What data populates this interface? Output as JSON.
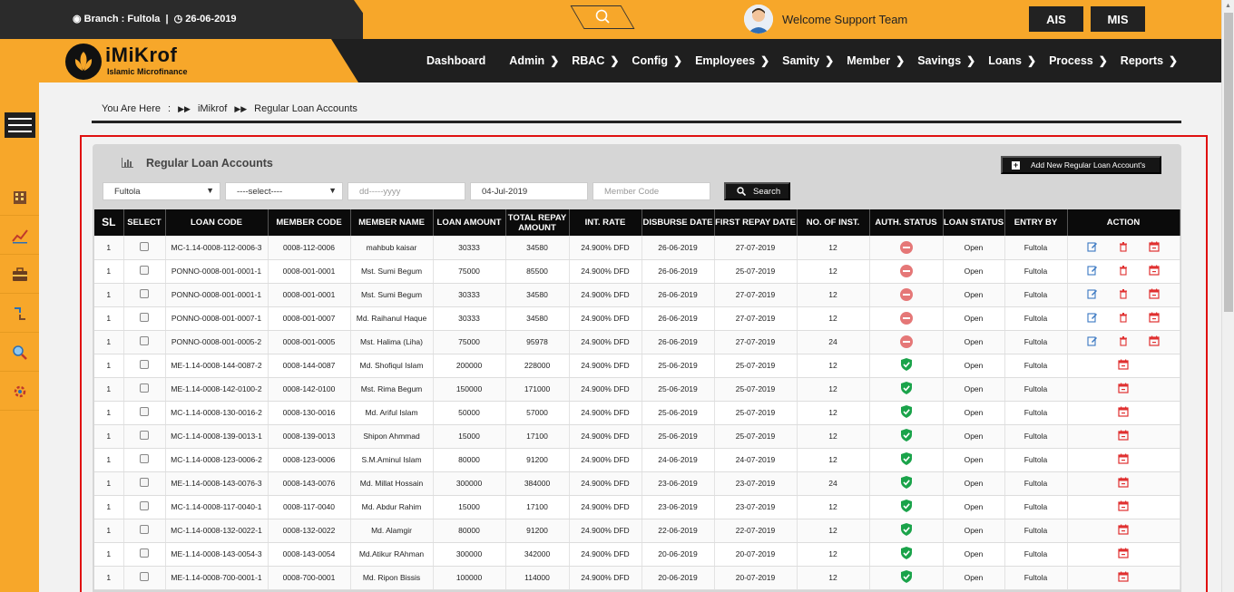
{
  "topbar": {
    "branch_label": "Branch : Fultola",
    "separator": "|",
    "date": "26-06-2019",
    "welcome": "Welcome Support Team",
    "btn_ais": "AIS",
    "btn_mis": "MIS"
  },
  "logo": {
    "title": "iMiKrof",
    "subtitle": "Islamic Microfinance"
  },
  "nav": [
    {
      "label": "Dashboard",
      "chevron": false
    },
    {
      "label": "Admin",
      "chevron": true
    },
    {
      "label": "RBAC",
      "chevron": true
    },
    {
      "label": "Config",
      "chevron": true
    },
    {
      "label": "Employees",
      "chevron": true
    },
    {
      "label": "Samity",
      "chevron": true
    },
    {
      "label": "Member",
      "chevron": true
    },
    {
      "label": "Savings",
      "chevron": true
    },
    {
      "label": "Loans",
      "chevron": true
    },
    {
      "label": "Process",
      "chevron": true
    },
    {
      "label": "Reports",
      "chevron": true
    }
  ],
  "breadcrumb": {
    "lead": "You Are Here",
    "colon": ":",
    "root": "iMikrof",
    "current": "Regular Loan Accounts"
  },
  "panel": {
    "title": "Regular Loan Accounts",
    "add_button": "Add New Regular Loan Account's"
  },
  "filters": {
    "branch": "Fultola",
    "product": "----select----",
    "date_from_placeholder": "dd-----yyyy",
    "date_to": "04-Jul-2019",
    "member_code_placeholder": "Member Code",
    "search_label": "Search"
  },
  "table": {
    "headers": [
      "SL",
      "SELECT",
      "LOAN CODE",
      "MEMBER CODE",
      "MEMBER NAME",
      "LOAN AMOUNT",
      "TOTAL REPAY AMOUNT",
      "INT. RATE",
      "DISBURSE DATE",
      "FIRST REPAY DATE",
      "NO. OF INST.",
      "AUTH. STATUS",
      "LOAN STATUS",
      "ENTRY BY",
      "ACTION"
    ],
    "rows": [
      {
        "sl": "1",
        "loan_code": "MC-1.14-0008-112-0006-3",
        "member_code": "0008-112-0006",
        "member_name": "mahbub kaisar",
        "loan_amount": "30333",
        "total_repay": "34580",
        "int_rate": "24.900% DFD",
        "disburse": "26-06-2019",
        "first_repay": "27-07-2019",
        "inst": "12",
        "auth": "pending",
        "loan_status": "Open",
        "entry_by": "Fultola",
        "full_actions": true
      },
      {
        "sl": "1",
        "loan_code": "PONNO-0008-001-0001-1",
        "member_code": "0008-001-0001",
        "member_name": "Mst. Sumi Begum",
        "loan_amount": "75000",
        "total_repay": "85500",
        "int_rate": "24.900% DFD",
        "disburse": "26-06-2019",
        "first_repay": "25-07-2019",
        "inst": "12",
        "auth": "pending",
        "loan_status": "Open",
        "entry_by": "Fultola",
        "full_actions": true
      },
      {
        "sl": "1",
        "loan_code": "PONNO-0008-001-0001-1",
        "member_code": "0008-001-0001",
        "member_name": "Mst. Sumi Begum",
        "loan_amount": "30333",
        "total_repay": "34580",
        "int_rate": "24.900% DFD",
        "disburse": "26-06-2019",
        "first_repay": "27-07-2019",
        "inst": "12",
        "auth": "pending",
        "loan_status": "Open",
        "entry_by": "Fultola",
        "full_actions": true
      },
      {
        "sl": "1",
        "loan_code": "PONNO-0008-001-0007-1",
        "member_code": "0008-001-0007",
        "member_name": "Md. Raihanul Haque",
        "loan_amount": "30333",
        "total_repay": "34580",
        "int_rate": "24.900% DFD",
        "disburse": "26-06-2019",
        "first_repay": "27-07-2019",
        "inst": "12",
        "auth": "pending",
        "loan_status": "Open",
        "entry_by": "Fultola",
        "full_actions": true
      },
      {
        "sl": "1",
        "loan_code": "PONNO-0008-001-0005-2",
        "member_code": "0008-001-0005",
        "member_name": "Mst. Halima (Liha)",
        "loan_amount": "75000",
        "total_repay": "95978",
        "int_rate": "24.900% DFD",
        "disburse": "26-06-2019",
        "first_repay": "27-07-2019",
        "inst": "24",
        "auth": "pending",
        "loan_status": "Open",
        "entry_by": "Fultola",
        "full_actions": true
      },
      {
        "sl": "1",
        "loan_code": "ME-1.14-0008-144-0087-2",
        "member_code": "0008-144-0087",
        "member_name": "Md. Shofiqul Islam",
        "loan_amount": "200000",
        "total_repay": "228000",
        "int_rate": "24.900% DFD",
        "disburse": "25-06-2019",
        "first_repay": "25-07-2019",
        "inst": "12",
        "auth": "approved",
        "loan_status": "Open",
        "entry_by": "Fultola",
        "full_actions": false
      },
      {
        "sl": "1",
        "loan_code": "ME-1.14-0008-142-0100-2",
        "member_code": "0008-142-0100",
        "member_name": "Mst. Rima Begum",
        "loan_amount": "150000",
        "total_repay": "171000",
        "int_rate": "24.900% DFD",
        "disburse": "25-06-2019",
        "first_repay": "25-07-2019",
        "inst": "12",
        "auth": "approved",
        "loan_status": "Open",
        "entry_by": "Fultola",
        "full_actions": false
      },
      {
        "sl": "1",
        "loan_code": "MC-1.14-0008-130-0016-2",
        "member_code": "0008-130-0016",
        "member_name": "Md. Ariful Islam",
        "loan_amount": "50000",
        "total_repay": "57000",
        "int_rate": "24.900% DFD",
        "disburse": "25-06-2019",
        "first_repay": "25-07-2019",
        "inst": "12",
        "auth": "approved",
        "loan_status": "Open",
        "entry_by": "Fultola",
        "full_actions": false
      },
      {
        "sl": "1",
        "loan_code": "MC-1.14-0008-139-0013-1",
        "member_code": "0008-139-0013",
        "member_name": "Shipon Ahmmad",
        "loan_amount": "15000",
        "total_repay": "17100",
        "int_rate": "24.900% DFD",
        "disburse": "25-06-2019",
        "first_repay": "25-07-2019",
        "inst": "12",
        "auth": "approved",
        "loan_status": "Open",
        "entry_by": "Fultola",
        "full_actions": false
      },
      {
        "sl": "1",
        "loan_code": "MC-1.14-0008-123-0006-2",
        "member_code": "0008-123-0006",
        "member_name": "S.M.Aminul Islam",
        "loan_amount": "80000",
        "total_repay": "91200",
        "int_rate": "24.900% DFD",
        "disburse": "24-06-2019",
        "first_repay": "24-07-2019",
        "inst": "12",
        "auth": "approved",
        "loan_status": "Open",
        "entry_by": "Fultola",
        "full_actions": false
      },
      {
        "sl": "1",
        "loan_code": "ME-1.14-0008-143-0076-3",
        "member_code": "0008-143-0076",
        "member_name": "Md. Millat Hossain",
        "loan_amount": "300000",
        "total_repay": "384000",
        "int_rate": "24.900% DFD",
        "disburse": "23-06-2019",
        "first_repay": "23-07-2019",
        "inst": "24",
        "auth": "approved",
        "loan_status": "Open",
        "entry_by": "Fultola",
        "full_actions": false
      },
      {
        "sl": "1",
        "loan_code": "MC-1.14-0008-117-0040-1",
        "member_code": "0008-117-0040",
        "member_name": "Md. Abdur Rahim",
        "loan_amount": "15000",
        "total_repay": "17100",
        "int_rate": "24.900% DFD",
        "disburse": "23-06-2019",
        "first_repay": "23-07-2019",
        "inst": "12",
        "auth": "approved",
        "loan_status": "Open",
        "entry_by": "Fultola",
        "full_actions": false
      },
      {
        "sl": "1",
        "loan_code": "MC-1.14-0008-132-0022-1",
        "member_code": "0008-132-0022",
        "member_name": "Md. Alamgir",
        "loan_amount": "80000",
        "total_repay": "91200",
        "int_rate": "24.900% DFD",
        "disburse": "22-06-2019",
        "first_repay": "22-07-2019",
        "inst": "12",
        "auth": "approved",
        "loan_status": "Open",
        "entry_by": "Fultola",
        "full_actions": false
      },
      {
        "sl": "1",
        "loan_code": "ME-1.14-0008-143-0054-3",
        "member_code": "0008-143-0054",
        "member_name": "Md.Atikur RAhman",
        "loan_amount": "300000",
        "total_repay": "342000",
        "int_rate": "24.900% DFD",
        "disburse": "20-06-2019",
        "first_repay": "20-07-2019",
        "inst": "12",
        "auth": "approved",
        "loan_status": "Open",
        "entry_by": "Fultola",
        "full_actions": false
      },
      {
        "sl": "1",
        "loan_code": "ME-1.14-0008-700-0001-1",
        "member_code": "0008-700-0001",
        "member_name": "Md. Ripon Bissis",
        "loan_amount": "100000",
        "total_repay": "114000",
        "int_rate": "24.900% DFD",
        "disburse": "20-06-2019",
        "first_repay": "20-07-2019",
        "inst": "12",
        "auth": "approved",
        "loan_status": "Open",
        "entry_by": "Fultola",
        "full_actions": false
      }
    ]
  },
  "colors": {
    "accent": "#f7a72a",
    "dark": "#1f1f1f",
    "danger": "#e01010",
    "approved": "#1aa34a"
  }
}
